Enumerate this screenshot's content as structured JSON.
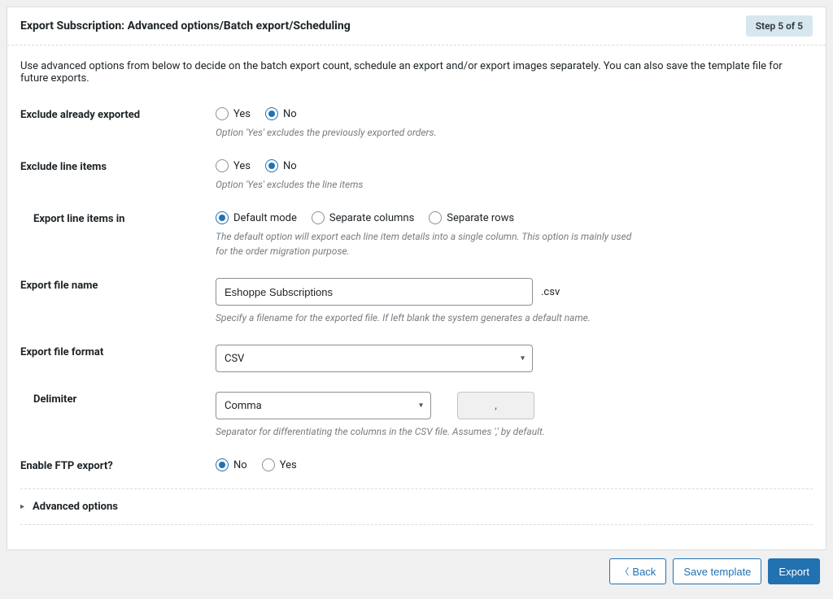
{
  "header": {
    "title": "Export Subscription: Advanced options/Batch export/Scheduling",
    "step_badge": "Step 5 of 5"
  },
  "intro": "Use advanced options from below to decide on the batch export count, schedule an export and/or export images separately. You can also save the template file for future exports.",
  "exclude_exported": {
    "label": "Exclude already exported",
    "yes": "Yes",
    "no": "No",
    "selected": "No",
    "help": "Option 'Yes' excludes the previously exported orders."
  },
  "exclude_line_items": {
    "label": "Exclude line items",
    "yes": "Yes",
    "no": "No",
    "selected": "No",
    "help": "Option 'Yes' excludes the line items"
  },
  "export_line_items_in": {
    "label": "Export line items in",
    "default_mode": "Default mode",
    "separate_columns": "Separate columns",
    "separate_rows": "Separate rows",
    "selected": "Default mode",
    "help": "The default option will export each line item details into a single column. This option is mainly used for the order migration purpose."
  },
  "file_name": {
    "label": "Export file name",
    "value": "Eshoppe Subscriptions",
    "ext": ".csv",
    "help": "Specify a filename for the exported file. If left blank the system generates a default name."
  },
  "file_format": {
    "label": "Export file format",
    "value": "CSV"
  },
  "delimiter": {
    "label": "Delimiter",
    "value": "Comma",
    "char": ",",
    "help": "Separator for differentiating the columns in the CSV file. Assumes ',' by default."
  },
  "ftp": {
    "label": "Enable FTP export?",
    "yes": "Yes",
    "no": "No",
    "selected": "No"
  },
  "advanced_accordion": {
    "title": "Advanced options"
  },
  "footer": {
    "back": "Back",
    "save_template": "Save template",
    "export": "Export"
  }
}
